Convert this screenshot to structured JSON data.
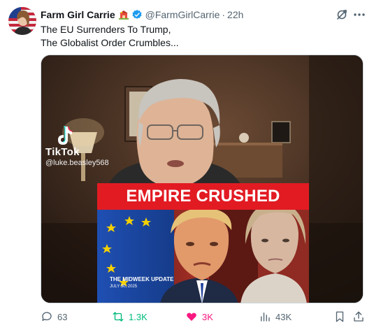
{
  "author": {
    "display_name": "Farm Girl Carrie",
    "handle": "@FarmGirlCarrie",
    "separator": "·",
    "time": "22h"
  },
  "tweet": {
    "lines": [
      "The EU Surrenders To Trump,",
      "The Globalist Order Crumbles..."
    ]
  },
  "media": {
    "watermark_app": "TikTok",
    "watermark_user": "@luke.beasley568",
    "banner_text": "EMPIRE CRUSHED",
    "thumb_title": "THE MIDWEEK UPDATE",
    "thumb_date": "JULY 30, 2025"
  },
  "actions": {
    "replies": "63",
    "reposts": "1.3K",
    "likes": "3K",
    "views": "43K"
  },
  "colors": {
    "verified": "#1d9bf0",
    "repost_active": "#00ba7c",
    "like_active": "#f91880",
    "banner_red": "#e21b23"
  },
  "icons": [
    "grok-icon",
    "more-icon",
    "verified-icon",
    "reply-icon",
    "repost-icon",
    "like-icon",
    "views-icon",
    "bookmark-icon",
    "share-icon"
  ]
}
